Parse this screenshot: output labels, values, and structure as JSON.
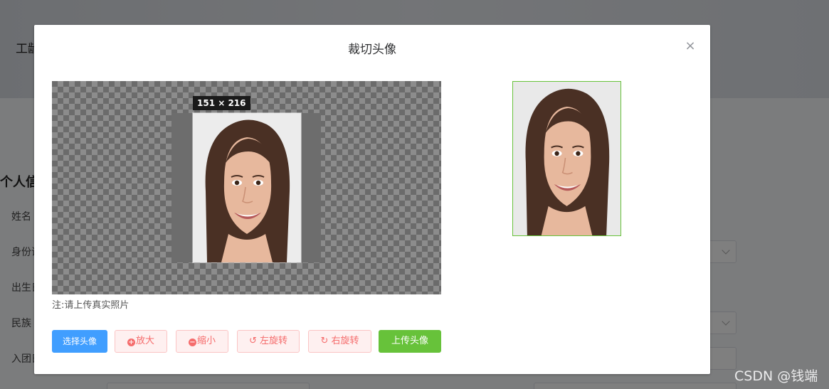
{
  "background": {
    "header_text": "工龄",
    "section_title": "个人信",
    "labels": [
      "姓名",
      "身份证",
      "出生日",
      "民族",
      "入团日"
    ]
  },
  "dialog": {
    "title": "裁切头像",
    "close_glyph": "×",
    "size_tag": "151 × 216",
    "note": "注:请上传真实照片",
    "buttons": {
      "select": "选择头像",
      "zoom_in": "放大",
      "zoom_out": "缩小",
      "rotate_left": "左旋转",
      "rotate_right": "右旋转",
      "upload": "上传头像"
    },
    "icons": {
      "zoom_in": "+",
      "zoom_out": "−",
      "rotate_left": "↺",
      "rotate_right": "↻"
    }
  },
  "watermark": "CSDN @钱端",
  "colors": {
    "primary": "#409eff",
    "danger": "#f56c6c",
    "success": "#67c23a"
  }
}
